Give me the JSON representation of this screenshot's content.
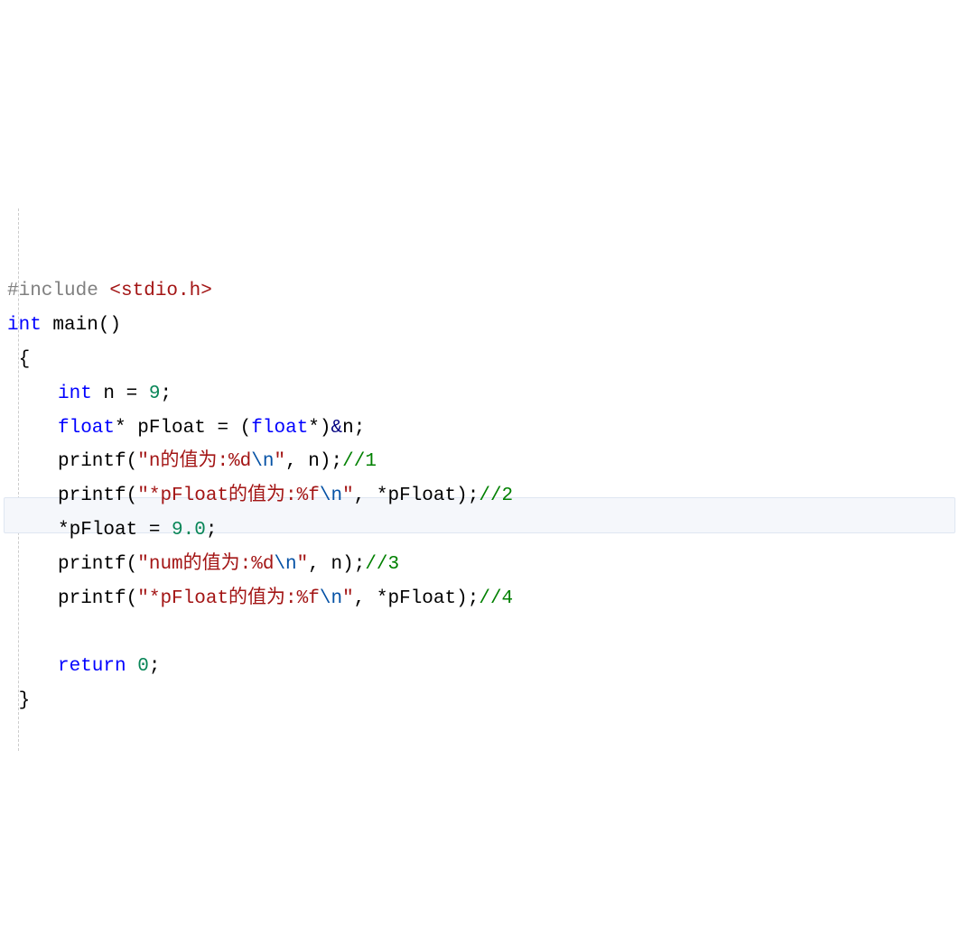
{
  "code": {
    "lines": [
      {
        "indent": 0,
        "segments": [
          {
            "cls": "tok-pp",
            "t": "#include "
          },
          {
            "cls": "tok-inc",
            "t": "<stdio.h>"
          }
        ]
      },
      {
        "indent": 0,
        "segments": [
          {
            "cls": "tok-kw",
            "t": "int"
          },
          {
            "cls": "tok-punct",
            "t": " "
          },
          {
            "cls": "tok-fn",
            "t": "main"
          },
          {
            "cls": "tok-punct",
            "t": "()"
          }
        ]
      },
      {
        "indent": 0,
        "segments": [
          {
            "cls": "tok-punct",
            "t": " {"
          }
        ]
      },
      {
        "indent": 1,
        "segments": [
          {
            "cls": "tok-kw",
            "t": "int"
          },
          {
            "cls": "tok-punct",
            "t": " "
          },
          {
            "cls": "tok-id",
            "t": "n"
          },
          {
            "cls": "tok-punct",
            "t": " = "
          },
          {
            "cls": "tok-num",
            "t": "9"
          },
          {
            "cls": "tok-punct",
            "t": ";"
          }
        ]
      },
      {
        "indent": 1,
        "segments": [
          {
            "cls": "tok-kw",
            "t": "float"
          },
          {
            "cls": "tok-punct",
            "t": "* "
          },
          {
            "cls": "tok-id",
            "t": "pFloat"
          },
          {
            "cls": "tok-punct",
            "t": " = ("
          },
          {
            "cls": "tok-kw",
            "t": "float"
          },
          {
            "cls": "tok-punct",
            "t": "*)"
          },
          {
            "cls": "tok-amp",
            "t": "&"
          },
          {
            "cls": "tok-id",
            "t": "n"
          },
          {
            "cls": "tok-punct",
            "t": ";"
          }
        ]
      },
      {
        "indent": 1,
        "segments": [
          {
            "cls": "tok-id",
            "t": "printf"
          },
          {
            "cls": "tok-punct",
            "t": "("
          },
          {
            "cls": "tok-str",
            "t": "\"n的值为:%d"
          },
          {
            "cls": "tok-esc",
            "t": "\\n"
          },
          {
            "cls": "tok-str",
            "t": "\""
          },
          {
            "cls": "tok-punct",
            "t": ", "
          },
          {
            "cls": "tok-id",
            "t": "n"
          },
          {
            "cls": "tok-punct",
            "t": ");"
          },
          {
            "cls": "tok-cmt",
            "t": "//1"
          }
        ]
      },
      {
        "indent": 1,
        "segments": [
          {
            "cls": "tok-id",
            "t": "printf"
          },
          {
            "cls": "tok-punct",
            "t": "("
          },
          {
            "cls": "tok-str",
            "t": "\"*pFloat的值为:%f"
          },
          {
            "cls": "tok-esc",
            "t": "\\n"
          },
          {
            "cls": "tok-str",
            "t": "\""
          },
          {
            "cls": "tok-punct",
            "t": ", *"
          },
          {
            "cls": "tok-id",
            "t": "pFloat"
          },
          {
            "cls": "tok-punct",
            "t": ");"
          },
          {
            "cls": "tok-cmt",
            "t": "//2"
          }
        ]
      },
      {
        "indent": 1,
        "segments": [
          {
            "cls": "tok-punct",
            "t": "*"
          },
          {
            "cls": "tok-id",
            "t": "pFloat"
          },
          {
            "cls": "tok-punct",
            "t": " = "
          },
          {
            "cls": "tok-num",
            "t": "9.0"
          },
          {
            "cls": "tok-punct",
            "t": ";"
          }
        ]
      },
      {
        "indent": 1,
        "segments": [
          {
            "cls": "tok-id",
            "t": "printf"
          },
          {
            "cls": "tok-punct",
            "t": "("
          },
          {
            "cls": "tok-str",
            "t": "\"num的值为:%d"
          },
          {
            "cls": "tok-esc",
            "t": "\\n"
          },
          {
            "cls": "tok-str",
            "t": "\""
          },
          {
            "cls": "tok-punct",
            "t": ", "
          },
          {
            "cls": "tok-id",
            "t": "n"
          },
          {
            "cls": "tok-punct",
            "t": ");"
          },
          {
            "cls": "tok-cmt",
            "t": "//3"
          }
        ]
      },
      {
        "indent": 1,
        "segments": [
          {
            "cls": "tok-id",
            "t": "printf"
          },
          {
            "cls": "tok-punct",
            "t": "("
          },
          {
            "cls": "tok-str",
            "t": "\"*pFloat的值为:%f"
          },
          {
            "cls": "tok-esc",
            "t": "\\n"
          },
          {
            "cls": "tok-str",
            "t": "\""
          },
          {
            "cls": "tok-punct",
            "t": ", *"
          },
          {
            "cls": "tok-id",
            "t": "pFloat"
          },
          {
            "cls": "tok-punct",
            "t": ");"
          },
          {
            "cls": "tok-cmt",
            "t": "//4"
          }
        ]
      },
      {
        "indent": 1,
        "segments": [
          {
            "cls": "tok-punct",
            "t": " "
          }
        ]
      },
      {
        "indent": 1,
        "segments": [
          {
            "cls": "tok-kw",
            "t": "return"
          },
          {
            "cls": "tok-punct",
            "t": " "
          },
          {
            "cls": "tok-num",
            "t": "0"
          },
          {
            "cls": "tok-punct",
            "t": ";"
          }
        ]
      },
      {
        "indent": 0,
        "segments": [
          {
            "cls": "tok-punct",
            "t": " }"
          }
        ]
      }
    ]
  }
}
